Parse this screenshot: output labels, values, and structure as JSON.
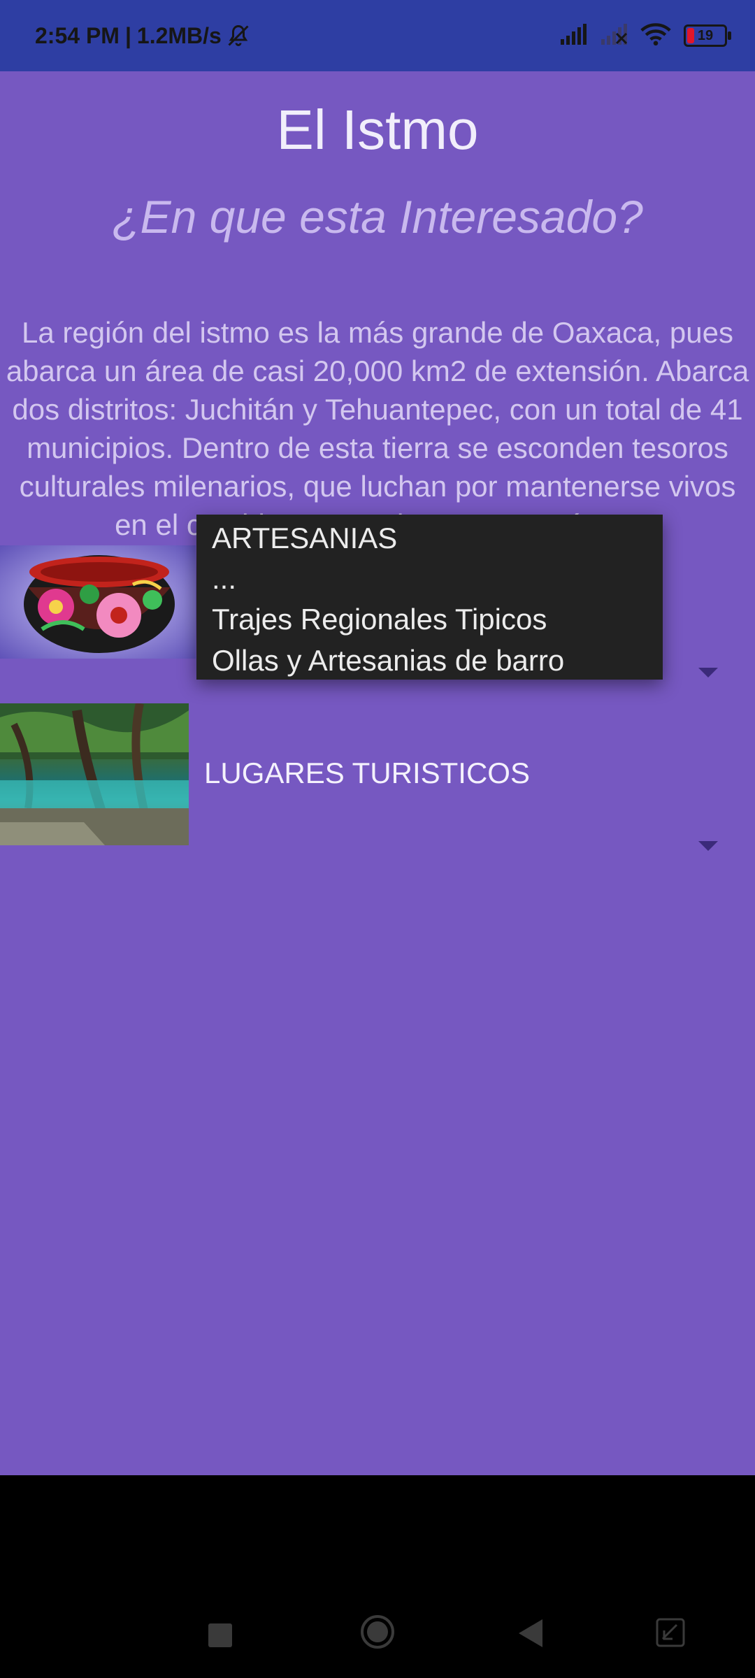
{
  "status_bar": {
    "time": "2:54 PM",
    "speed": "1.2MB/s",
    "separator": "|",
    "battery_level": "19",
    "icons": [
      "bell-off-icon",
      "signal-icon",
      "signal-off-icon",
      "wifi-icon",
      "battery-icon"
    ]
  },
  "app": {
    "title": "El Istmo",
    "subtitle": "¿En que esta Interesado?",
    "description": "La región del istmo es la más grande de Oaxaca, pues abarca un área de casi 20,000 km2 de extensión. Abarca dos distritos: Juchitán y Tehuantepec, con un total de 41 municipios. Dentro de esta tierra se esconden tesoros culturales milenarios, que luchan por mantenerse vivos en el cambiante mundo contemporáneo.",
    "background_color": "#7658c1"
  },
  "spinners": [
    {
      "image": "painted-gourd-image",
      "options": [
        "ARTESANIAS",
        "...",
        "Trajes Regionales Tipicos",
        "Ollas y Artesanias de barro"
      ],
      "expanded": true
    },
    {
      "image": "river-trees-image",
      "selected": "LUGARES TURISTICOS",
      "expanded": false
    }
  ],
  "nav_bar": {
    "icons": [
      "recents-square-icon",
      "home-circle-icon",
      "back-triangle-icon",
      "screenshot-icon"
    ]
  }
}
